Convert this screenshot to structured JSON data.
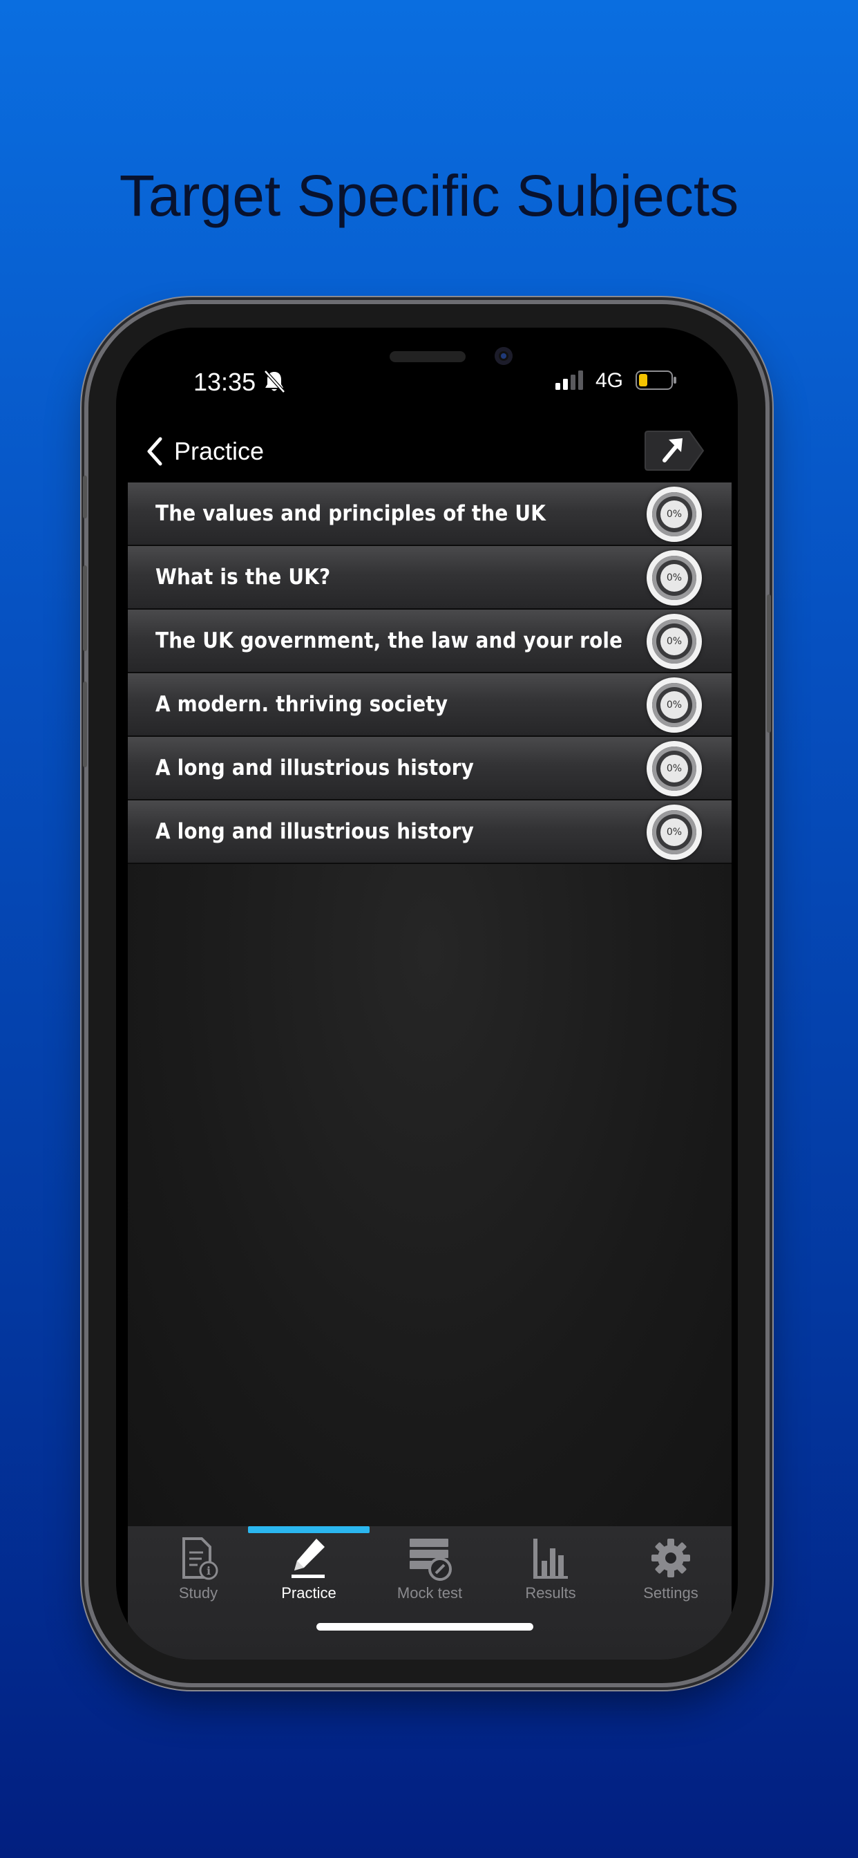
{
  "headline": "Target Specific Subjects",
  "status_bar": {
    "time": "13:35",
    "network": "4G",
    "silent_icon": "bell-slash-icon",
    "signal_icon": "cellular-signal-icon",
    "battery_icon": "battery-low-icon"
  },
  "nav": {
    "back_label": "Practice",
    "back_icon": "chevron-left-icon",
    "share_icon": "share-arrow-icon"
  },
  "topics": [
    {
      "label": "The values and principles of the UK",
      "progress": "0%"
    },
    {
      "label": "What is the UK?",
      "progress": "0%"
    },
    {
      "label": "The UK government, the law and your role",
      "progress": "0%"
    },
    {
      "label": "A modern. thriving society",
      "progress": "0%"
    },
    {
      "label": "A long and illustrious history",
      "progress": "0%"
    },
    {
      "label": "A long and illustrious history",
      "progress": "0%"
    }
  ],
  "tabs": [
    {
      "label": "Study",
      "icon": "study-document-icon",
      "active": false
    },
    {
      "label": "Practice",
      "icon": "pencil-icon",
      "active": true
    },
    {
      "label": "Mock test",
      "icon": "mock-test-icon",
      "active": false
    },
    {
      "label": "Results",
      "icon": "bar-chart-icon",
      "active": false
    },
    {
      "label": "Settings",
      "icon": "gear-icon",
      "active": false
    }
  ],
  "colors": {
    "tab_indicator": "#2bb7f0",
    "background_top": "#0a6ee0",
    "background_bottom": "#021f80",
    "battery_level": "#f5c400"
  }
}
